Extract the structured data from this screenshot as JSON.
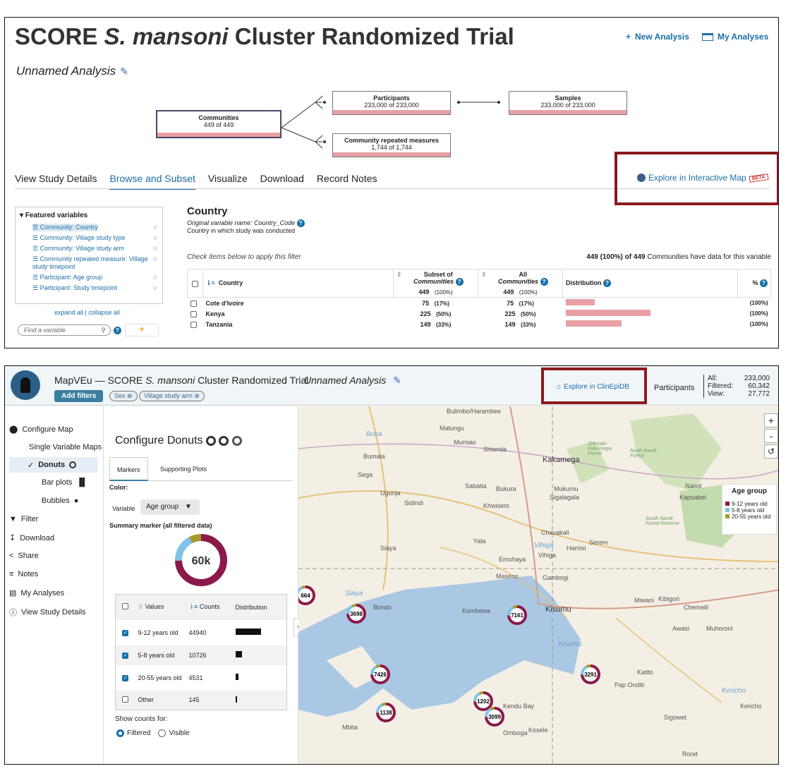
{
  "top": {
    "title_prefix": "SCORE",
    "title_species": "S. mansoni",
    "title_suffix": "Cluster Randomized Trial",
    "new_analysis": "New Analysis",
    "my_analyses": "My Analyses",
    "analysis_name": "Unnamed Analysis",
    "nodes": {
      "communities": {
        "title": "Communities",
        "count": "449 of 449"
      },
      "participants": {
        "title": "Participants",
        "count": "233,000 of 233,000"
      },
      "samples": {
        "title": "Samples",
        "count": "233,000 of 233,000"
      },
      "repeated": {
        "title": "Community repeated measures",
        "count": "1,744 of 1,744"
      }
    },
    "tabs": [
      "View Study Details",
      "Browse and Subset",
      "Visualize",
      "Download",
      "Record Notes"
    ],
    "explore_map": "Explore in Interactive Map",
    "beta": "BETA",
    "featured_title": "Featured variables",
    "featured": [
      {
        "label": "Community: Country"
      },
      {
        "label": "Community: Village study type"
      },
      {
        "label": "Community: Village study arm"
      },
      {
        "label": "Community repeated measure: Village study timepoint"
      },
      {
        "label": "Participant: Age group"
      },
      {
        "label": "Participant: Study timepoint"
      }
    ],
    "expand_all": "expand all",
    "collapse_all": "collapse all",
    "find_placeholder": "Find a variable",
    "variable_title": "Country",
    "original_name": "Original variable name: Country_Code",
    "description": "Country in which study was conducted",
    "check_note": "Check items below to apply this filter",
    "data_note_bold": "449 (100%) of 449",
    "data_note_rest": "Communities have data for this variable",
    "table": {
      "col_country": "Country",
      "col_subset": "Subset of",
      "col_all": "All",
      "col_communities": "Communities",
      "col_distribution": "Distribution",
      "col_pct": "%",
      "subset_total": "449",
      "subset_total_pct": "(100%)",
      "all_total": "449",
      "all_total_pct": "(100%)",
      "rows": [
        {
          "name": "Cote d'Ivoire",
          "subset": "75",
          "subset_pct": "(17%)",
          "all": "75",
          "all_pct": "(17%)",
          "dist": 0.17,
          "pct": "(100%)"
        },
        {
          "name": "Kenya",
          "subset": "225",
          "subset_pct": "(50%)",
          "all": "225",
          "all_pct": "(50%)",
          "dist": 0.5,
          "pct": "(100%)"
        },
        {
          "name": "Tanzania",
          "subset": "149",
          "subset_pct": "(33%)",
          "all": "149",
          "all_pct": "(33%)",
          "dist": 0.33,
          "pct": "(100%)"
        }
      ]
    }
  },
  "mapveu": {
    "app_name": "MapVEu",
    "dash": "—",
    "title_prefix": "SCORE",
    "title_species": "S. mansoni",
    "title_suffix": "Cluster Randomized Trial",
    "analysis_name": "Unnamed Analysis",
    "add_filters": "Add filters",
    "chips": [
      "Sex",
      "Village study arm"
    ],
    "explore_clinepi": "Explore in ClinEpiDB",
    "participants": "Participants",
    "counts": [
      {
        "label": "All:",
        "value": "233,000"
      },
      {
        "label": "Filtered:",
        "value": "60,342"
      },
      {
        "label": "View:",
        "value": "27,772"
      }
    ],
    "nav": {
      "configure_map": "Configure Map",
      "single_var": "Single Variable Maps",
      "donuts": "Donuts",
      "bar_plots": "Bar plots",
      "bubbles": "Bubbles",
      "filter": "Filter",
      "download": "Download",
      "share": "Share",
      "notes": "Notes",
      "my_analyses": "My Analyses",
      "view_study": "View Study Details"
    },
    "config": {
      "title": "Configure Donuts",
      "tab_markers": "Markers",
      "tab_supporting": "Supporting Plots",
      "color_label": "Color:",
      "variable_label": "Variable",
      "variable_value": "Age group",
      "summary_label": "Summary marker (all filtered data)",
      "summary_value": "60k",
      "col_values": "Values",
      "col_counts": "Counts",
      "col_distribution": "Distribution",
      "rows": [
        {
          "value": "9-12 years old",
          "count": "44940",
          "fraction": 1.0,
          "checked": true
        },
        {
          "value": "5-8 years old",
          "count": "10726",
          "fraction": 0.24,
          "checked": true
        },
        {
          "value": "20-55 years old",
          "count": "4531",
          "fraction": 0.1,
          "checked": true
        },
        {
          "value": "Other",
          "count": "145",
          "fraction": 0.01,
          "checked": false
        }
      ],
      "show_counts": "Show counts for:",
      "filtered": "Filtered",
      "visible": "Visible"
    },
    "legend": {
      "title": "Age group",
      "items": [
        {
          "label": "9-12 years old",
          "color": "#8b1a4a"
        },
        {
          "label": "5-8 years old",
          "color": "#7ec4e8"
        },
        {
          "label": "20-55 years old",
          "color": "#a89a2a"
        }
      ]
    },
    "markers": [
      {
        "label": "664"
      },
      {
        "label": "3698"
      },
      {
        "label": "7161"
      },
      {
        "label": "7426"
      },
      {
        "label": "3291"
      },
      {
        "label": "1138"
      },
      {
        "label": "1202"
      },
      {
        "label": "3099"
      }
    ],
    "place_labels": {
      "busia": "Busia",
      "bumala": "Bumala",
      "sega": "Sega",
      "ugunja": "Ugunja",
      "sidindi": "Sidindi",
      "siaya": "Siaya",
      "bondo": "Bondo",
      "kakamega": "Kakamega",
      "kisumu": "Kisumu",
      "kisumu2": "Kisumu",
      "mumias": "Mumias",
      "matungu": "Matungu",
      "shianda": "Shianda",
      "sabatia": "Sabatia",
      "mukumu": "Mukumu",
      "chavakali": "Chavakali",
      "vihiga": "Vihiga",
      "hamisi": "Hamisi",
      "serem": "Serem",
      "gambogi": "Gambogi",
      "maseno": "Maseno",
      "emuhaya": "Emuhaya",
      "kombewa": "Kombewa",
      "miwani": "Miwani",
      "chemelil": "Chemelil",
      "awasi": "Awasi",
      "muhoroni": "Muhoroni",
      "katito": "Katito",
      "pap_onditi": "Pap Onditi",
      "kericho": "Kericho",
      "kericho2": "Kericho",
      "sigowet": "Sigowet",
      "kendu_bay": "Kendu Bay",
      "omboga": "Omboga",
      "kosele": "Kosele",
      "mbita": "Mbita",
      "nandi": "Nandi",
      "kapsabet": "Kapsabet",
      "sigalagala": "Sigalagala",
      "khwisero": "Khwisero",
      "vihiga2": "Vihiga",
      "ebuhaya": "Yala",
      "kibigori": "Kibigori",
      "bulimbo": "Bulimbo/Harambee",
      "north_nandi": "North Nandi Forest",
      "south_nandi": "South Nandi Forest Reserve",
      "kakamega_forest": "Shinyalu Kakamega Forest",
      "bukura": "Bukura",
      "rongo": "Roret"
    }
  }
}
